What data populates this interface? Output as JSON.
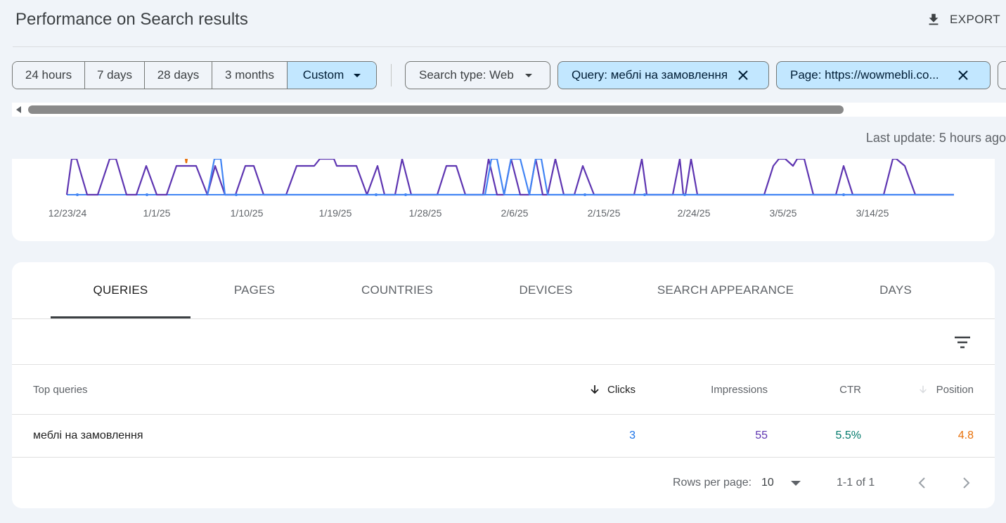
{
  "header": {
    "title": "Performance on Search results",
    "export_label": "EXPORT"
  },
  "filters": {
    "date_ranges": [
      {
        "label": "24 hours"
      },
      {
        "label": "7 days"
      },
      {
        "label": "28 days"
      },
      {
        "label": "3 months"
      },
      {
        "label": "Custom",
        "selected": true
      }
    ],
    "search_type": "Search type: Web",
    "query_chip": "Query: меблі на замовлення",
    "page_chip": "Page: https://wowmebli.co..."
  },
  "status": {
    "last_update": "Last update: 5 hours ago"
  },
  "chart": {
    "x_ticks": [
      "12/23/24",
      "1/1/25",
      "1/10/25",
      "1/19/25",
      "1/28/25",
      "2/6/25",
      "2/15/25",
      "2/24/25",
      "3/5/25",
      "3/14/25"
    ],
    "colors": {
      "clicks": "#4285f4",
      "impressions": "#5e35b1",
      "position": "#e8710a"
    }
  },
  "tabs": [
    {
      "label": "QUERIES",
      "active": true
    },
    {
      "label": "PAGES"
    },
    {
      "label": "COUNTRIES"
    },
    {
      "label": "DEVICES"
    },
    {
      "label": "SEARCH APPEARANCE"
    },
    {
      "label": "DAYS"
    }
  ],
  "table": {
    "headers": {
      "query": "Top queries",
      "clicks": "Clicks",
      "impressions": "Impressions",
      "ctr": "CTR",
      "position": "Position"
    },
    "rows": [
      {
        "query": "меблі на замовлення",
        "clicks": "3",
        "impressions": "55",
        "ctr": "5.5%",
        "position": "4.8"
      }
    ],
    "colors": {
      "clicks": "#1a73e8",
      "impressions": "#5e35b1",
      "ctr": "#00796b",
      "position": "#e8710a"
    }
  },
  "pagination": {
    "rows_per_page_label": "Rows per page:",
    "rows_per_page_value": "10",
    "range_label": "1-1 of 1"
  }
}
